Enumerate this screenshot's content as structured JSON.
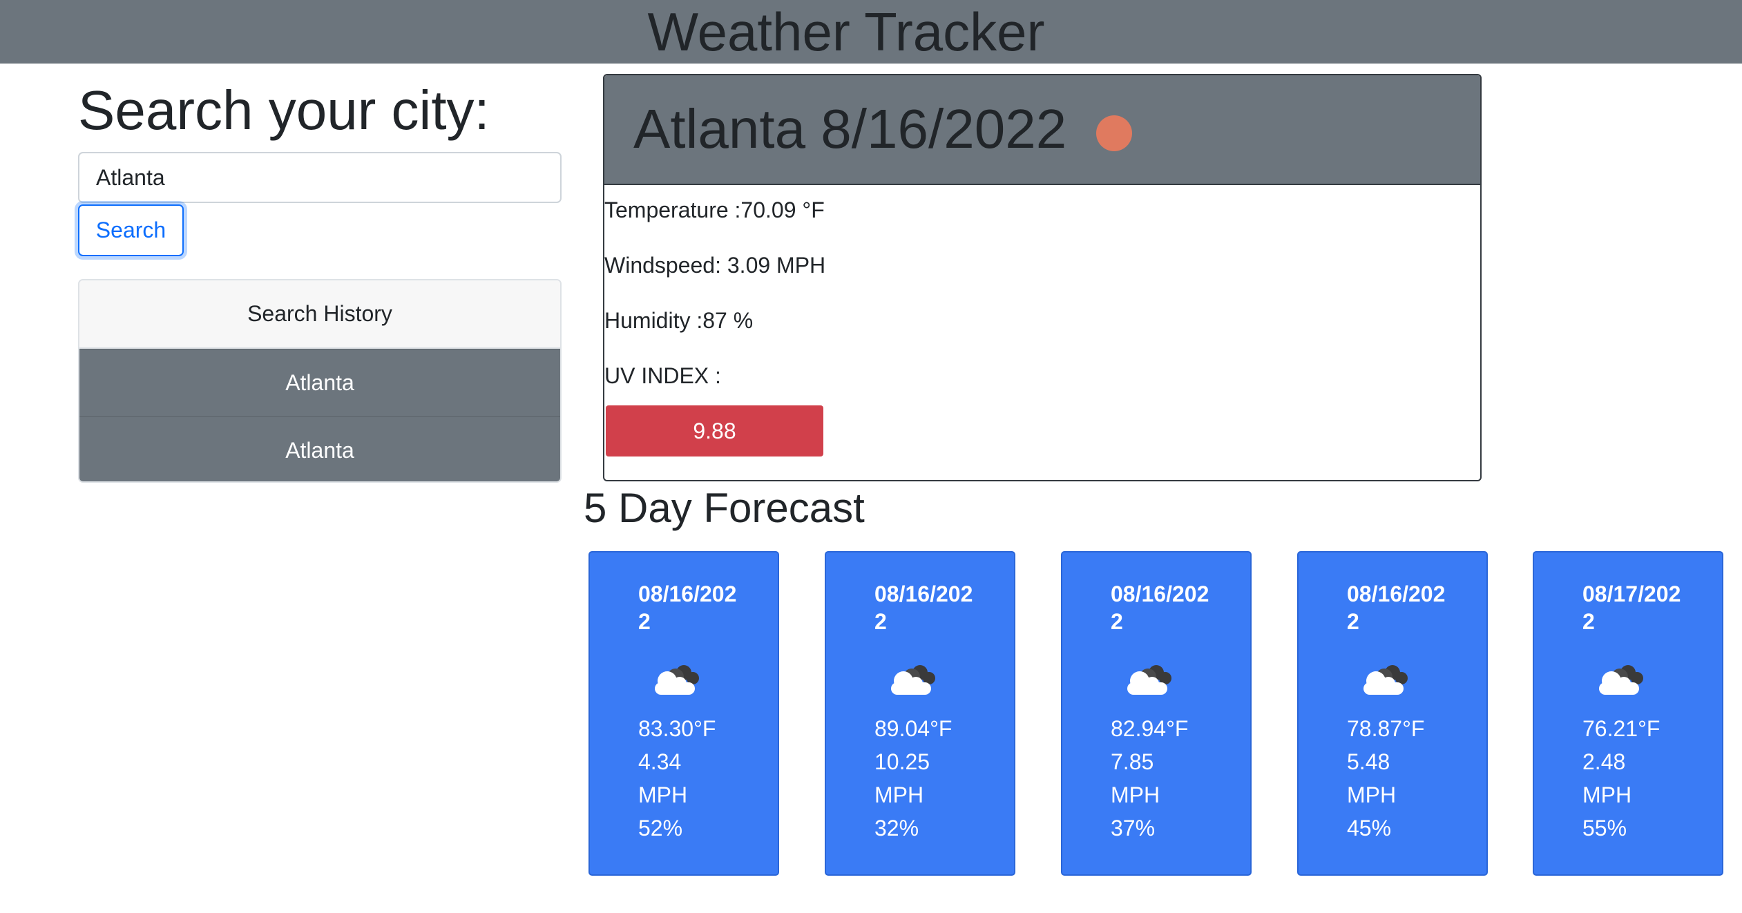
{
  "header": {
    "title": "Weather Tracker"
  },
  "search": {
    "heading": "Search your city:",
    "input_value": "Atlanta",
    "button_label": "Search"
  },
  "history": {
    "title": "Search History",
    "items": [
      "Atlanta",
      "Atlanta"
    ]
  },
  "current": {
    "title": "Atlanta 8/16/2022",
    "icon": "sun-icon",
    "temperature": "Temperature :70.09 °F",
    "windspeed": "Windspeed: 3.09 MPH",
    "humidity": "Humidity :87 %",
    "uv_label": "UV INDEX :",
    "uv_value": "9.88",
    "uv_color": "#d1404b"
  },
  "forecast": {
    "heading": "5 Day Forecast",
    "card_color": "#3a7bf5",
    "days": [
      {
        "date": "08/16/2022",
        "icon": "cloud-icon",
        "temp": "83.30°F",
        "wind": "4.34",
        "wind_unit": "MPH",
        "humidity": "52%"
      },
      {
        "date": "08/16/2022",
        "icon": "cloud-icon",
        "temp": "89.04°F",
        "wind": "10.25",
        "wind_unit": "MPH",
        "humidity": "32%"
      },
      {
        "date": "08/16/2022",
        "icon": "cloud-icon",
        "temp": "82.94°F",
        "wind": "7.85",
        "wind_unit": "MPH",
        "humidity": "37%"
      },
      {
        "date": "08/16/2022",
        "icon": "cloud-icon",
        "temp": "78.87°F",
        "wind": "5.48",
        "wind_unit": "MPH",
        "humidity": "45%"
      },
      {
        "date": "08/17/2022",
        "icon": "cloud-icon",
        "temp": "76.21°F",
        "wind": "2.48",
        "wind_unit": "MPH",
        "humidity": "55%"
      }
    ]
  }
}
